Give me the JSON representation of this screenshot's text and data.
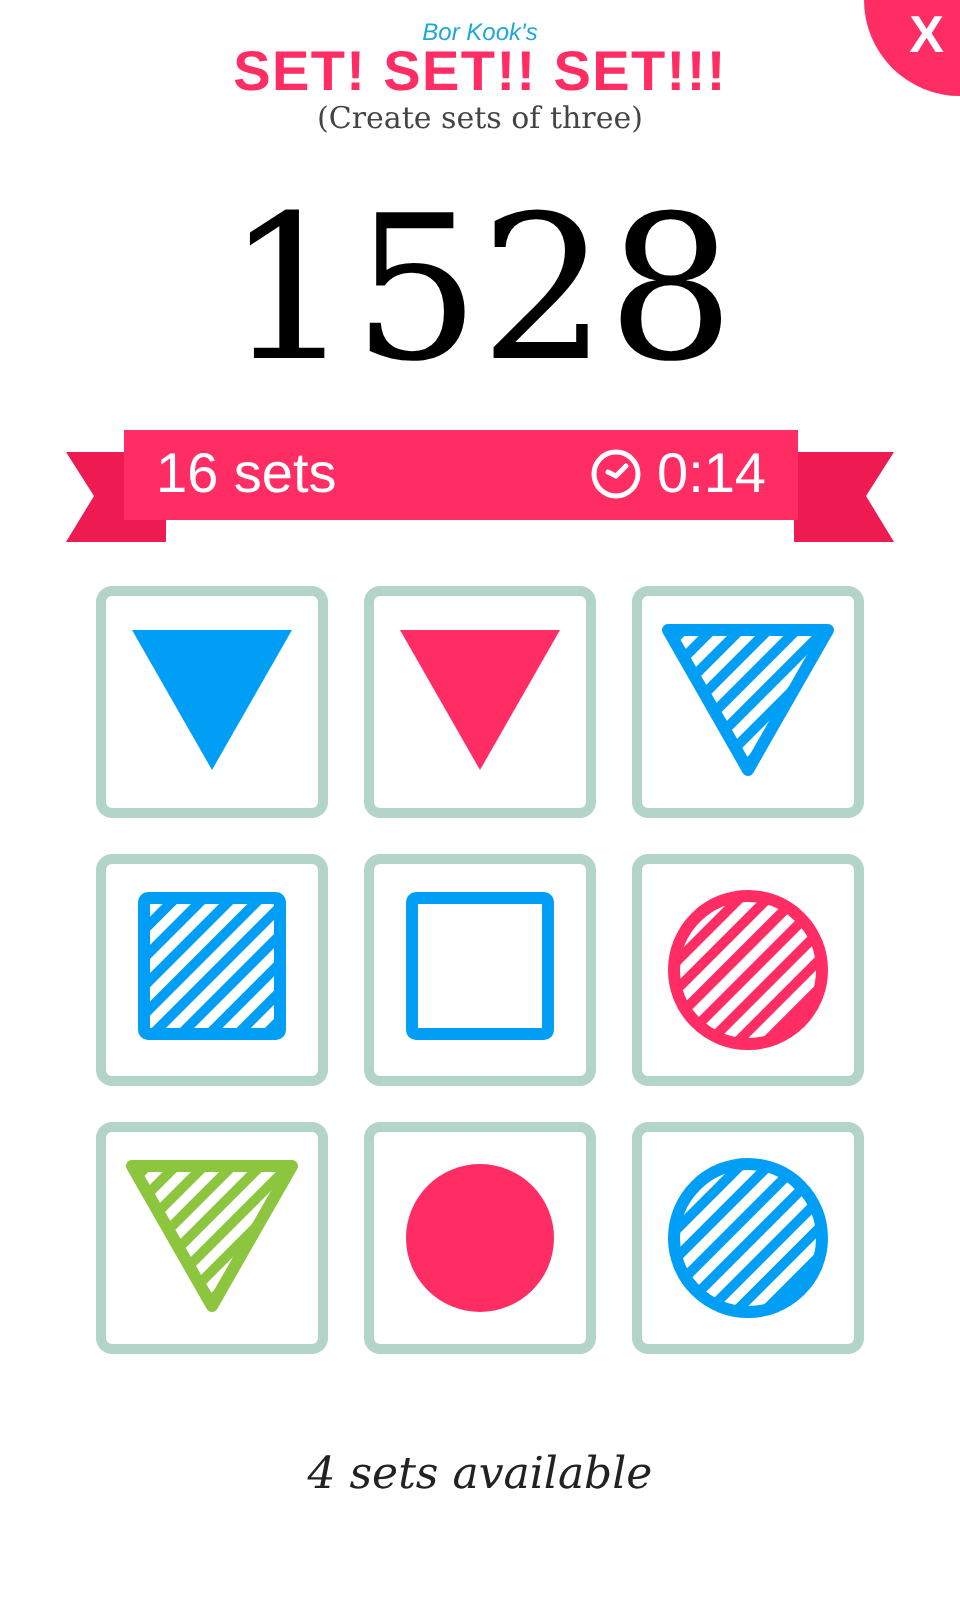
{
  "header": {
    "byline": "Bor Kook's",
    "title": "SET! SET!! SET!!!",
    "subtitle": "(Create sets of three)"
  },
  "close_button": {
    "label": "X"
  },
  "score": "1528",
  "ribbon": {
    "sets_found": "16 sets",
    "timer": "0:14"
  },
  "cards": [
    {
      "kind": "triangle",
      "solid": true,
      "striped": false,
      "color": "#009ff5"
    },
    {
      "kind": "triangle",
      "solid": true,
      "striped": false,
      "color": "#ff2d64"
    },
    {
      "kind": "triangle",
      "solid": false,
      "striped": true,
      "color": "#009ff5"
    },
    {
      "kind": "square",
      "solid": false,
      "striped": true,
      "color": "#009ff5"
    },
    {
      "kind": "square",
      "solid": false,
      "striped": false,
      "color": "#009ff5"
    },
    {
      "kind": "circle",
      "solid": false,
      "striped": true,
      "color": "#ff2d64"
    },
    {
      "kind": "triangle",
      "solid": false,
      "striped": true,
      "color": "#8cc63f"
    },
    {
      "kind": "circle",
      "solid": true,
      "striped": false,
      "color": "#ff2d64"
    },
    {
      "kind": "circle",
      "solid": false,
      "striped": true,
      "color": "#009ff5"
    }
  ],
  "footer": "4 sets available"
}
